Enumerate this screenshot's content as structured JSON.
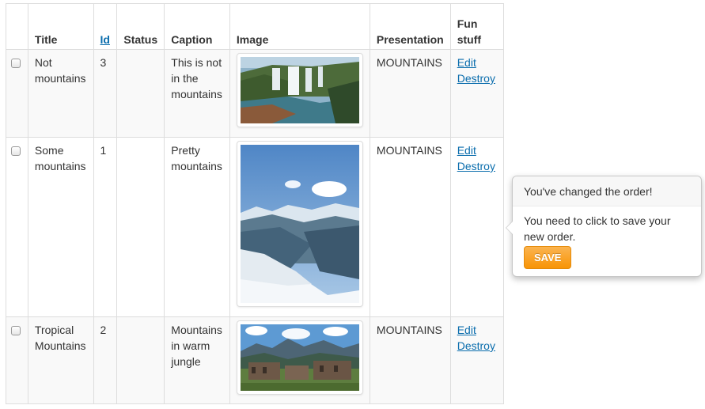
{
  "table": {
    "headers": {
      "title": "Title",
      "id": "Id",
      "status": "Status",
      "caption": "Caption",
      "image": "Image",
      "presentation": "Presentation",
      "fun_stuff": "Fun stuff"
    },
    "rows": [
      {
        "title": "Not mountains",
        "id": "3",
        "status": "",
        "caption": "This is not in the mountains",
        "image_icon": "waterfall-photo",
        "presentation": "MOUNTAINS",
        "edit": "Edit",
        "destroy": "Destroy"
      },
      {
        "title": "Some mountains",
        "id": "1",
        "status": "",
        "caption": "Pretty mountains",
        "image_icon": "snowy-mountain-photo",
        "presentation": "MOUNTAINS",
        "edit": "Edit",
        "destroy": "Destroy"
      },
      {
        "title": "Tropical Mountains",
        "id": "2",
        "status": "",
        "caption": "Mountains in warm jungle",
        "image_icon": "ruins-mountain-photo",
        "presentation": "MOUNTAINS",
        "edit": "Edit",
        "destroy": "Destroy"
      }
    ]
  },
  "popover": {
    "title": "You've changed the order!",
    "body": "You need to click to save your new order.",
    "save_label": "SAVE"
  },
  "colors": {
    "link": "#0a6dad",
    "save_button": "#f89406",
    "row_stripe": "#f9f9f9",
    "border": "#dddddd"
  }
}
